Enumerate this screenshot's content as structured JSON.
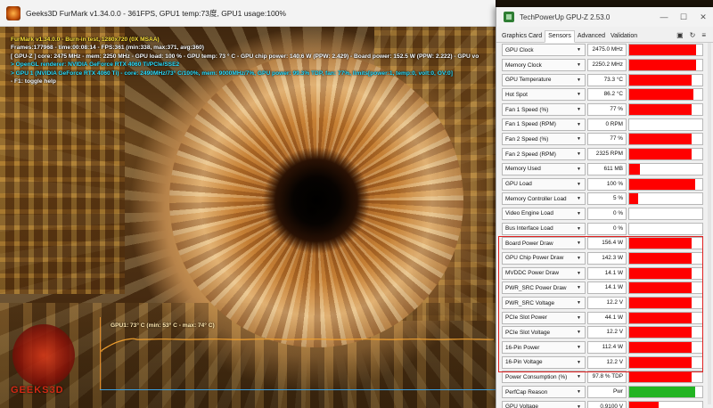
{
  "furmark": {
    "window_title": "Geeks3D FurMark v1.34.0.0 - 361FPS, GPU1 temp:73度, GPU1 usage:100%",
    "hud": [
      {
        "text": "FurMark v1.34.0.0 - Burn-in test, 1280x720 (0X MSAA)",
        "color": "yellow"
      },
      {
        "text": "Frames:177968 - time:00:08:14 - FPS:361 (min:338, max:371, avg:360)",
        "color": "white"
      },
      {
        "text": "[ GPU-Z ] core: 2475 MHz - mem: 2250 MHz - GPU load: 100 % - GPU temp: 73 ° C - GPU chip power: 140.6 W (PPW: 2.429) - Board power: 152.5 W (PPW: 2.222) - GPU vo",
        "color": "white"
      },
      {
        "text": "> OpenGL renderer: NVIDIA GeForce RTX 4060 Ti/PCIe/SSE2",
        "color": "cyan"
      },
      {
        "text": "> GPU 1 (NVIDIA GeForce RTX 4060 Ti) - core: 2490MHz/73° C/100%, mem: 9000MHz/7%, GPU power: 99.3% TDP, fan: 77%, limits[power:1, temp:0, volt:0, OV:0]",
        "color": "cyan"
      },
      {
        "text": "- F1: toggle help",
        "color": "white"
      }
    ],
    "temp_graph_label": "GPU1: 73° C (min: 53° C - max: 74° C)",
    "temp_graph": {
      "min": 53,
      "max": 74,
      "current": 73
    },
    "logo_text": "GEEKS3D"
  },
  "gpuz": {
    "window_title": "TechPowerUp GPU-Z 2.53.0",
    "win_controls": [
      "—",
      "☐",
      "✕"
    ],
    "tabs": [
      "Graphics Card",
      "Sensors",
      "Advanced",
      "Validation"
    ],
    "active_tab": "Sensors",
    "tools": [
      "camera-icon",
      "refresh-icon",
      "menu-icon"
    ],
    "fill_color": "#ff0000",
    "fill_color_ok": "#22b422",
    "sensors": [
      {
        "name": "GPU Clock",
        "value": "2475.0 MHz",
        "level": 0.92
      },
      {
        "name": "Memory Clock",
        "value": "2250.2 MHz",
        "level": 0.92
      },
      {
        "name": "GPU Temperature",
        "value": "73.3 °C",
        "level": 0.85
      },
      {
        "name": "Hot Spot",
        "value": "86.2 °C",
        "level": 0.88
      },
      {
        "name": "Fan 1 Speed (%)",
        "value": "77 %",
        "level": 0.85
      },
      {
        "name": "Fan 1 Speed (RPM)",
        "value": "0 RPM",
        "level": 0
      },
      {
        "name": "Fan 2 Speed (%)",
        "value": "77 %",
        "level": 0.85
      },
      {
        "name": "Fan 2 Speed (RPM)",
        "value": "2325 RPM",
        "level": 0.85
      },
      {
        "name": "Memory Used",
        "value": "611 MB",
        "level": 0.15
      },
      {
        "name": "GPU Load",
        "value": "100 %",
        "level": 0.9
      },
      {
        "name": "Memory Controller Load",
        "value": "5 %",
        "level": 0.12
      },
      {
        "name": "Video Engine Load",
        "value": "0 %",
        "level": 0
      },
      {
        "name": "Bus Interface Load",
        "value": "0 %",
        "level": 0
      },
      {
        "name": "Board Power Draw",
        "value": "156.4 W",
        "level": 0.85
      },
      {
        "name": "GPU Chip Power Draw",
        "value": "142.3 W",
        "level": 0.85
      },
      {
        "name": "MVDDC Power Draw",
        "value": "14.1 W",
        "level": 0.85
      },
      {
        "name": "PWR_SRC Power Draw",
        "value": "14.1 W",
        "level": 0.85
      },
      {
        "name": "PWR_SRC Voltage",
        "value": "12.2 V",
        "level": 0.85
      },
      {
        "name": "PCIe Slot Power",
        "value": "44.1 W",
        "level": 0.85
      },
      {
        "name": "PCIe Slot Voltage",
        "value": "12.2 V",
        "level": 0.85
      },
      {
        "name": "16-Pin Power",
        "value": "112.4 W",
        "level": 0.85
      },
      {
        "name": "16-Pin Voltage",
        "value": "12.2 V",
        "level": 0.85
      },
      {
        "name": "Power Consumption (%)",
        "value": "97.8 % TDP",
        "level": 0.85
      },
      {
        "name": "PerfCap Reason",
        "value": "Pwr",
        "level": 0.9,
        "ok": true
      },
      {
        "name": "GPU Voltage",
        "value": "0.9100 V",
        "level": 0.4
      }
    ]
  }
}
